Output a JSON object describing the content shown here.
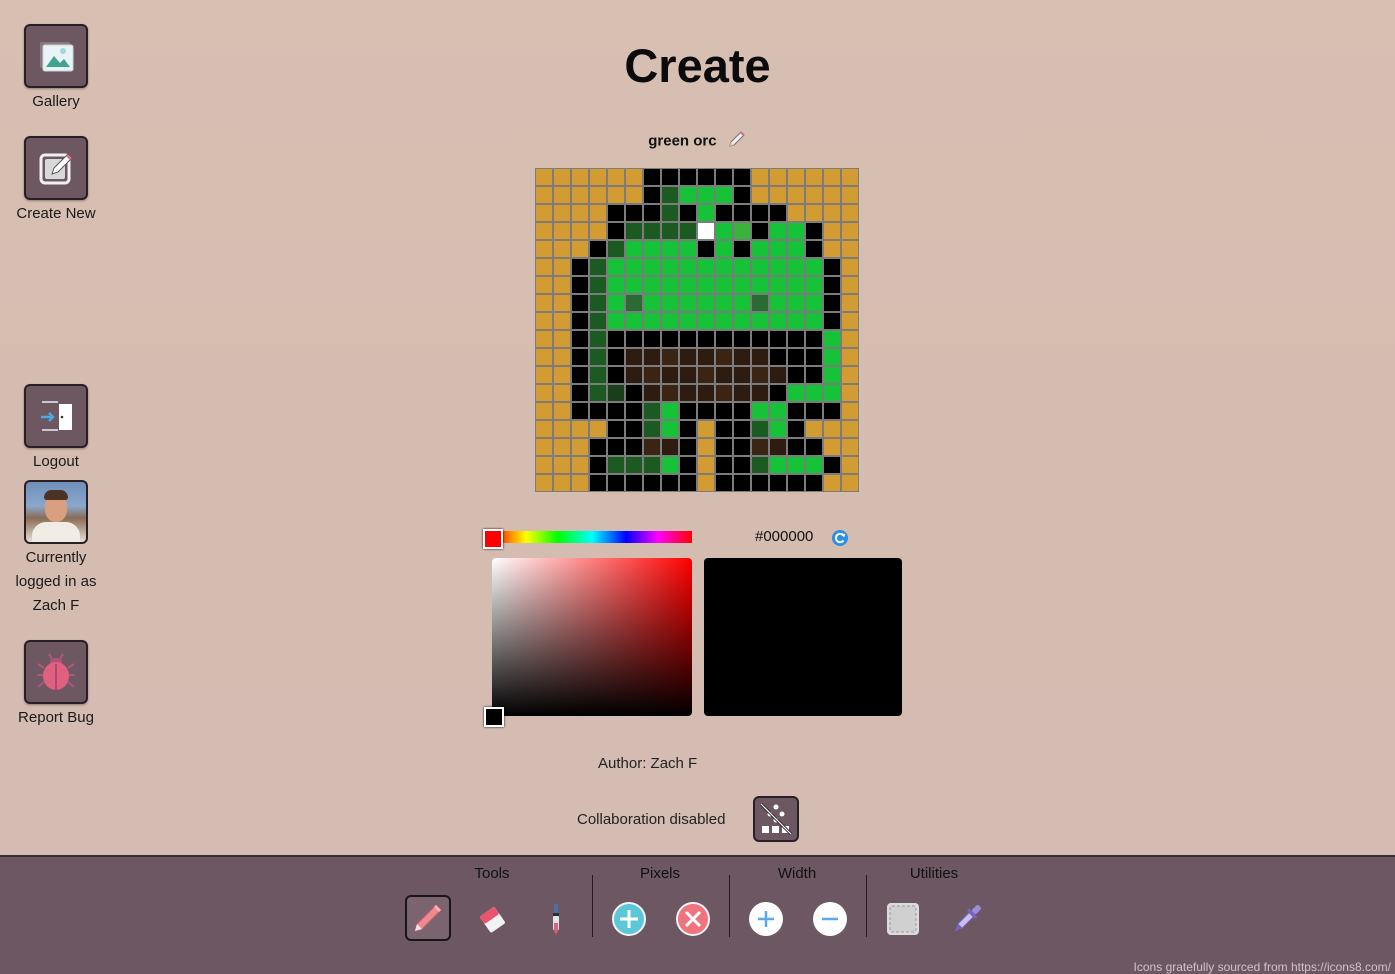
{
  "sidebar": {
    "gallery_label": "Gallery",
    "create_new_label": "Create New",
    "logout_label": "Logout",
    "user_line1": "Currently",
    "user_line2": "logged in as",
    "user_name": "Zach F",
    "report_bug_label": "Report Bug"
  },
  "page": {
    "title": "Create",
    "art_name": "green orc"
  },
  "pixel_art": {
    "size": 18,
    "palette": {
      "K": "#000000",
      "Y": "#d29c32",
      "G": "#16c238",
      "D": "#1b5a20",
      "W": "#ffffff",
      "L": "#3ab33a",
      "M": "#2a6a34",
      "B": "#2e1c10",
      "C": "#3a2414",
      "N": "#1a3d1a"
    },
    "rows": [
      "YYYYYYKKKKKKYYYYYY",
      "YYYYYYKDGGGKYYYYYY",
      "YYYYKKKDKGKKKKYYYY",
      "YYYYKDDDDWGLKGGKYY",
      "YYYKDGGGGKGKGGGKYY",
      "YYKDGGGGGGGGGGGGKY",
      "YYKDGGGGGGGGGGGGKY",
      "YYKDGMGGGGGGMGGGKY",
      "YYKDGGGGGGGGGGGGKY",
      "YYKDKKKKKKKKKKKKGY",
      "YYKDKBBCBBCBBKKKGY",
      "YYKDKBCBBCBBCBKKGY",
      "YYKDNKBCBBCBBKGGGY",
      "YYKKKKDGKKKKGGKKKY",
      "YYYYKKDGKYKKDGKYYY",
      "YYYKKKCBKYKKCBKKYY",
      "YYYKDDDGKYKKDGGGKY",
      "YYYKKKKKKYKKKKKKYY"
    ]
  },
  "color_picker": {
    "hex_value": "#000000",
    "hue_color": "#ff0000",
    "selected_color": "#000000"
  },
  "meta": {
    "author": "Author: Zach F",
    "collaboration": "Collaboration disabled"
  },
  "toolbar": {
    "tools_label": "Tools",
    "pixels_label": "Pixels",
    "width_label": "Width",
    "utilities_label": "Utilities",
    "active_tool": "pencil"
  },
  "footer": {
    "credits": "Icons gratefully sourced from https://icons8.com/"
  },
  "colors": {
    "background": "#d5bcb0",
    "sidebar_button": "#6d5862",
    "toolbar": "#6d5762"
  }
}
